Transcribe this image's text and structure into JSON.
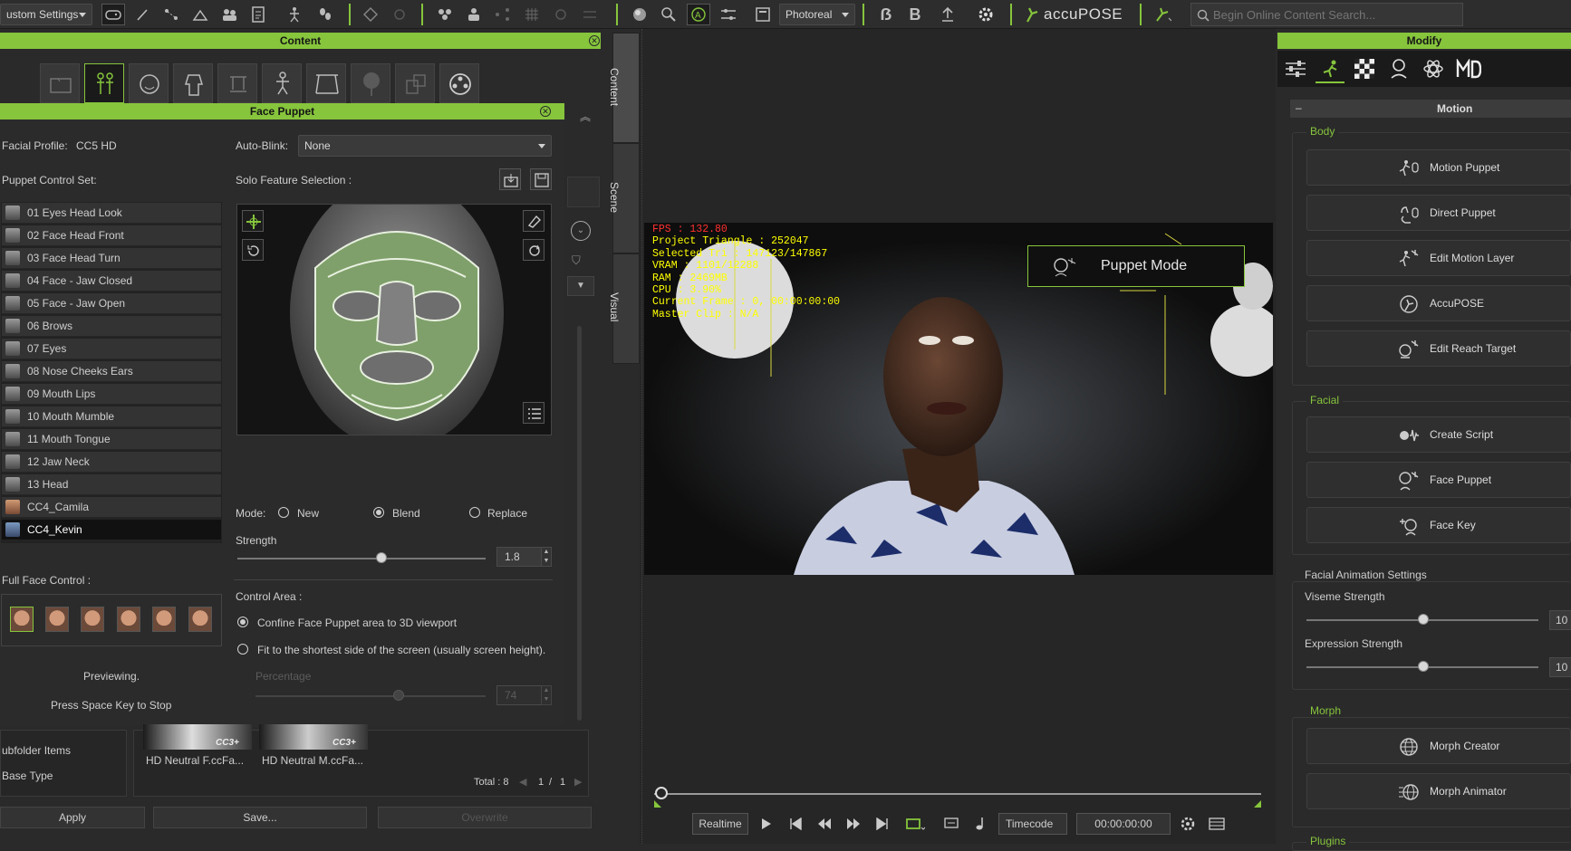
{
  "toolbar": {
    "layout_dropdown": "ustom Settings",
    "render_dropdown": "Photoreal",
    "accupose_label": "accuPOSE",
    "search_placeholder": "Begin Online Content Search..."
  },
  "content_panel": {
    "title": "Content"
  },
  "face_puppet": {
    "title": "Face Puppet",
    "facial_profile_label": "Facial Profile:",
    "facial_profile_value": "CC5 HD",
    "auto_blink_label": "Auto-Blink:",
    "auto_blink_value": "None",
    "puppet_control_set_label": "Puppet Control Set:",
    "solo_feature_label": "Solo Feature Selection :",
    "control_sets": [
      "01 Eyes Head Look",
      "02 Face Head Front",
      "03 Face Head Turn",
      "04 Face - Jaw Closed",
      "05 Face - Jaw Open",
      "06 Brows",
      "07 Eyes",
      "08 Nose Cheeks Ears",
      "09 Mouth Lips",
      "10 Mouth Mumble",
      "11 Mouth Tongue",
      "12 Jaw Neck",
      "13 Head",
      "CC4_Camila",
      "CC4_Kevin"
    ],
    "selected_set": "CC4_Kevin",
    "mode_label": "Mode:",
    "mode_new": "New",
    "mode_blend": "Blend",
    "mode_replace": "Replace",
    "mode_selected": "Blend",
    "strength_label": "Strength",
    "strength_value": "1.8",
    "full_face_label": "Full Face Control :",
    "control_area_label": "Control Area :",
    "confine_label": "Confine Face Puppet area to 3D viewport",
    "fit_label": "Fit to the shortest side of the screen (usually screen height).",
    "percentage_label": "Percentage",
    "percentage_value": "74",
    "previewing": "Previewing.",
    "press_space": "Press Space Key to Stop"
  },
  "content_lower": {
    "subfolder_items": "ubfolder Items",
    "base_type": "Base Type",
    "items": [
      {
        "label": "HD Neutral F.ccFa...",
        "badge": "CC3+"
      },
      {
        "label": "HD Neutral M.ccFa...",
        "badge": "CC3+"
      }
    ],
    "total": "Total : 8",
    "page": "1",
    "page_sep": "/",
    "pages": "1",
    "apply": "Apply",
    "save": "Save...",
    "overwrite": "Overwrite"
  },
  "side_tabs": [
    "Content",
    "Scene",
    "Visual"
  ],
  "viewport": {
    "fps": "FPS : 132.80",
    "stats": [
      "Project Triangle : 252047",
      "Selected Tri : 147123/147867",
      "VRAM : 1101/12288",
      "RAM : 2469MB",
      "CPU : 3.90%",
      "Current Frame : 0, 00:00:00:00",
      "Master Clip : N/A"
    ],
    "puppet_mode": "Puppet Mode"
  },
  "playback": {
    "realtime": "Realtime",
    "timecode": "Timecode",
    "time": "00:00:00:00"
  },
  "modify": {
    "title": "Modify",
    "motion_header": "Motion",
    "body_label": "Body",
    "body_buttons": [
      "Motion Puppet",
      "Direct Puppet",
      "Edit Motion Layer",
      "AccuPOSE",
      "Edit Reach Target"
    ],
    "facial_label": "Facial",
    "facial_buttons": [
      "Create Script",
      "Face Puppet",
      "Face Key"
    ],
    "facial_anim_label": "Facial Animation Settings",
    "viseme_label": "Viseme Strength",
    "viseme_value": "10",
    "expression_label": "Expression Strength",
    "expression_value": "10",
    "morph_label": "Morph",
    "morph_buttons": [
      "Morph Creator",
      "Morph Animator"
    ],
    "plugins_label": "Plugins"
  },
  "colors": {
    "accent": "#86c53c",
    "panel": "#2a2a2a",
    "viewport_text": "#ffff00",
    "fps_text": "#ff3030"
  }
}
